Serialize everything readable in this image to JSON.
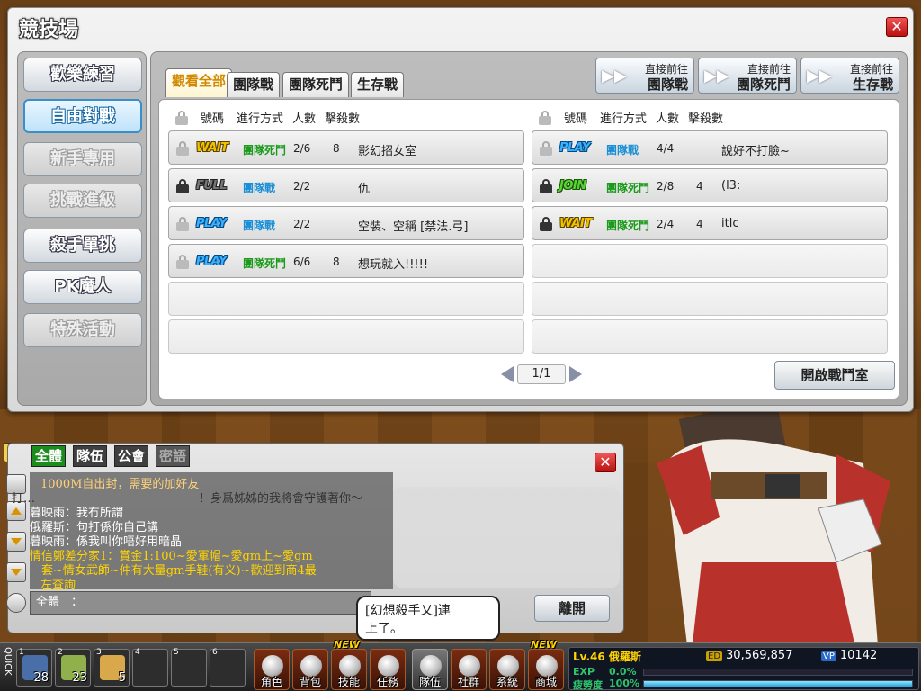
{
  "window": {
    "title": "競技場",
    "close_label": "✕"
  },
  "sidebar": {
    "items": [
      {
        "label": "歡樂練習",
        "state": "normal"
      },
      {
        "label": "自由對戰",
        "state": "active"
      },
      {
        "label": "新手專用",
        "state": "disabled"
      },
      {
        "label": "挑戰進級",
        "state": "disabled"
      },
      {
        "label": "殺手單挑",
        "state": "normal"
      },
      {
        "label": "PK魔人",
        "state": "normal"
      },
      {
        "label": "特殊活動",
        "state": "disabled"
      }
    ]
  },
  "tabs": [
    {
      "label": "觀看全部",
      "active": true
    },
    {
      "label": "團隊戰",
      "active": false
    },
    {
      "label": "團隊死鬥",
      "active": false
    },
    {
      "label": "生存戰",
      "active": false
    }
  ],
  "nav_buttons": [
    {
      "line1": "直接前往",
      "line2": "團隊戰"
    },
    {
      "line1": "直接前往",
      "line2": "團隊死鬥"
    },
    {
      "line1": "直接前往",
      "line2": "生存戰"
    }
  ],
  "columns": {
    "number": "號碼",
    "mode": "進行方式",
    "players": "人數",
    "kills": "擊殺數"
  },
  "rooms_left": [
    {
      "status": "WAIT",
      "mode": "團隊死鬥",
      "players": "2/6",
      "kills": "8",
      "name": "影幻招女室",
      "locked": false
    },
    {
      "status": "FULL",
      "mode": "團隊戰",
      "players": "2/2",
      "kills": "",
      "name": "仇",
      "locked": true
    },
    {
      "status": "PLAY",
      "mode": "團隊戰",
      "players": "2/2",
      "kills": "",
      "name": "空裝、空稱 [禁法.弓]",
      "locked": false
    },
    {
      "status": "PLAY",
      "mode": "團隊死鬥",
      "players": "6/6",
      "kills": "8",
      "name": "想玩就入!!!!!",
      "locked": false
    }
  ],
  "rooms_right": [
    {
      "status": "PLAY",
      "mode": "團隊戰",
      "players": "4/4",
      "kills": "",
      "name": "說好不打臉~",
      "locked": false
    },
    {
      "status": "JOIN",
      "mode": "團隊死鬥",
      "players": "2/8",
      "kills": "4",
      "name": "(l3:",
      "locked": true
    },
    {
      "status": "WAIT",
      "mode": "團隊死鬥",
      "players": "2/4",
      "kills": "4",
      "name": "itlc",
      "locked": true
    }
  ],
  "pager": {
    "label": "1/1"
  },
  "open_room_label": "開啟戰鬥室",
  "chat": {
    "tabs": [
      {
        "label": "全體",
        "state": "active"
      },
      {
        "label": "隊伍",
        "state": "normal"
      },
      {
        "label": "公會",
        "state": "normal"
      },
      {
        "label": "密語",
        "state": "dim"
      }
    ],
    "lines": [
      {
        "text": "1000M自出封，需要的加好友",
        "color": "#ffd27a"
      },
      {
        "text": "打…　　　　　　　　　　　　　　！身爲姊姊的我將會守護著你～",
        "color": "#333333"
      },
      {
        "text": "暮映雨：我冇所謂",
        "color": "#ffffff"
      },
      {
        "text": "俄羅斯：句打係你自己講",
        "color": "#ffffff"
      },
      {
        "text": "暮映雨：係我叫你唔好用暗晶",
        "color": "#ffffff"
      },
      {
        "text": "情信鄭差分家1：賞金1:100~愛軍帽~愛gm上~愛gm",
        "color": "#ffd400"
      },
      {
        "text": "　套~情女武師~仲有大量gm手鞋(有义)~歡迎到商4最",
        "color": "#ffd400"
      },
      {
        "text": "左查詢",
        "color": "#ffd400"
      }
    ],
    "input_prefix": "全體　："
  },
  "leave_label": "離開",
  "popup": {
    "line1": "[幻想殺手乂]連",
    "line2": "上了。"
  },
  "quickslots": [
    {
      "n": "1",
      "count": "28"
    },
    {
      "n": "2",
      "count": "23"
    },
    {
      "n": "3",
      "count": "5"
    },
    {
      "n": "4",
      "count": ""
    },
    {
      "n": "5",
      "count": ""
    },
    {
      "n": "6",
      "count": ""
    }
  ],
  "quick_label": "QUICK",
  "menu": [
    {
      "label": "角色",
      "new": false
    },
    {
      "label": "背包",
      "new": false
    },
    {
      "label": "技能",
      "new": true
    },
    {
      "label": "任務",
      "new": false
    },
    {
      "label": "隊伍",
      "new": false
    },
    {
      "label": "社群",
      "new": false
    },
    {
      "label": "系統",
      "new": false
    },
    {
      "label": "商城",
      "new": true
    }
  ],
  "new_label": "NEW",
  "player": {
    "level": "Lv.46 俄羅斯",
    "ed_badge": "ED",
    "ed": "30,569,857",
    "vp_badge": "VP",
    "vp": "10142",
    "exp_label": "EXP",
    "exp_value": "0.0%",
    "exp_fraction": 0.0,
    "fatigue_label": "疲勞度",
    "fatigue_value": "100%",
    "fatigue_fraction": 1.0
  },
  "help_label": "?"
}
